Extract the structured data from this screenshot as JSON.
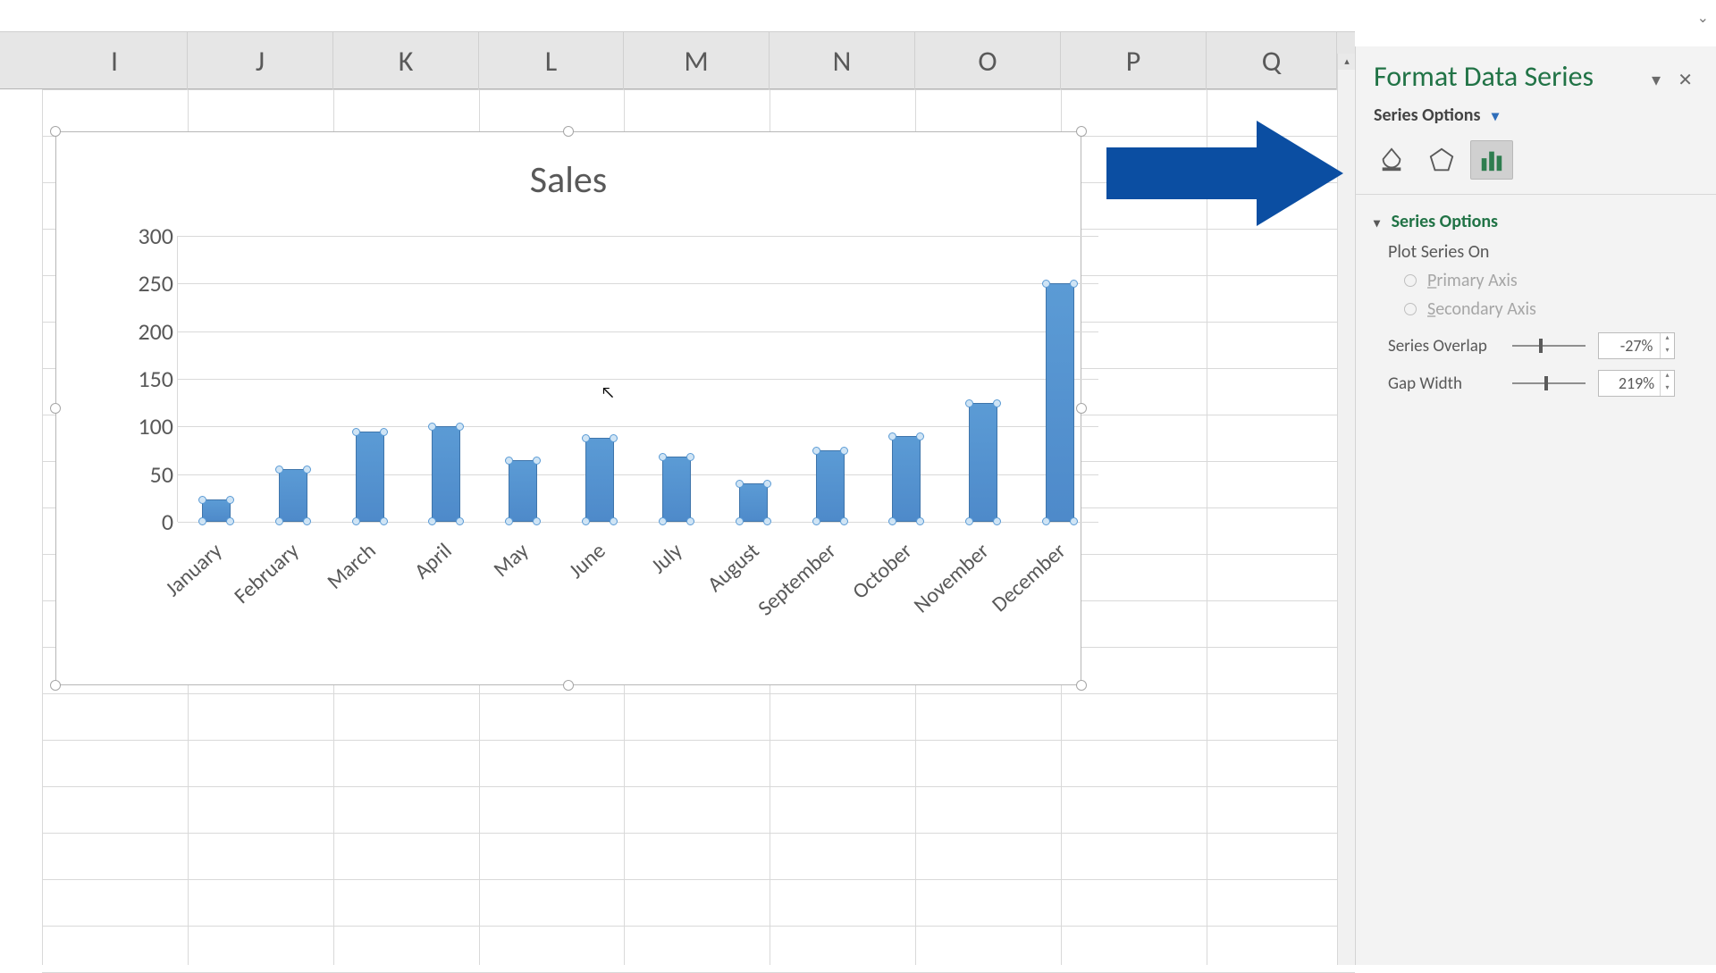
{
  "columns": [
    "I",
    "J",
    "K",
    "L",
    "M",
    "N",
    "O",
    "P",
    "Q"
  ],
  "pane": {
    "title": "Format Data Series",
    "series_options_label": "Series Options",
    "section_label": "Series Options",
    "plot_on_label": "Plot Series On",
    "primary_axis": "Primary Axis",
    "secondary_axis": "Secondary Axis",
    "overlap_label": "Series Overlap",
    "overlap_value": "-27%",
    "gap_label": "Gap Width",
    "gap_value": "219%"
  },
  "chart_data": {
    "type": "bar",
    "title": "Sales",
    "categories": [
      "January",
      "February",
      "March",
      "April",
      "May",
      "June",
      "July",
      "August",
      "September",
      "October",
      "November",
      "December"
    ],
    "values": [
      23,
      55,
      95,
      100,
      65,
      88,
      68,
      40,
      75,
      90,
      125,
      250
    ],
    "ylabel": "",
    "xlabel": "",
    "ylim": [
      0,
      300
    ],
    "y_ticks": [
      0,
      50,
      100,
      150,
      200,
      250,
      300
    ]
  }
}
